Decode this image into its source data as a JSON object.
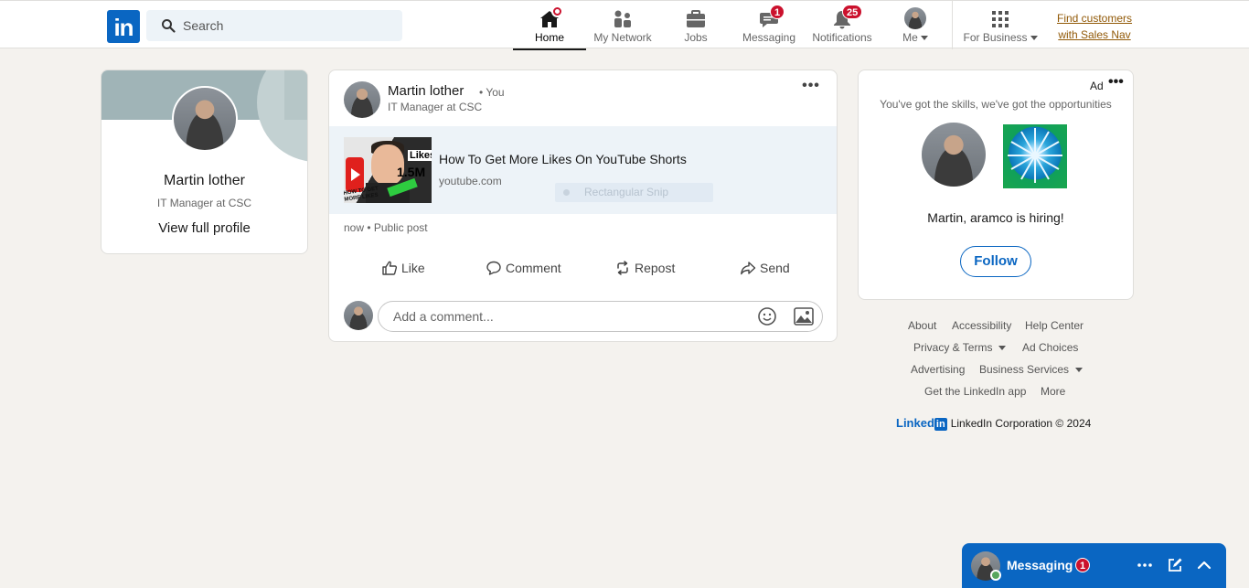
{
  "nav": {
    "logo_text": "in",
    "search": {
      "placeholder": "Search"
    },
    "items": [
      {
        "label": "Home",
        "icon": "home-icon",
        "active": true
      },
      {
        "label": "My Network",
        "icon": "network-icon"
      },
      {
        "label": "Jobs",
        "icon": "briefcase-icon"
      },
      {
        "label": "Messaging",
        "icon": "chat-icon",
        "badge": "1"
      },
      {
        "label": "Notifications",
        "icon": "bell-icon",
        "badge": "25"
      },
      {
        "label": "Me",
        "icon": "avatar"
      },
      {
        "label": "For Business",
        "icon": "grid-icon"
      }
    ],
    "sales_nav": {
      "line1": "Find customers",
      "line2": "with Sales Nav"
    }
  },
  "profile": {
    "name": "Martin lother",
    "title": "IT Manager at CSC",
    "link": "View full profile"
  },
  "post": {
    "author": "Martin lother",
    "you_tag": "• You",
    "author_title": "IT Manager at CSC",
    "more": "•••",
    "link": {
      "title": "How To Get More Likes On YouTube Shorts",
      "domain": "youtube.com",
      "thumb_text1": "Likes",
      "thumb_text2": "1.5M",
      "thumb_text3": "HOW TO GET MORE LIKES"
    },
    "snip_overlay": "Rectangular Snip",
    "meta": "now • Public post",
    "actions": {
      "like": "Like",
      "comment": "Comment",
      "repost": "Repost",
      "send": "Send"
    },
    "comment_placeholder": "Add a comment..."
  },
  "ad": {
    "label": "Ad",
    "more": "•••",
    "tagline": "You've got the skills, we've got the opportunities",
    "hiring_prefix": "Martin, ",
    "hiring_company": "aramco",
    "hiring_suffix": " is hiring!",
    "follow": "Follow"
  },
  "footer": {
    "links": {
      "about": "About",
      "accessibility": "Accessibility",
      "help_center": "Help Center",
      "privacy_terms": "Privacy & Terms",
      "ad_choices": "Ad Choices",
      "advertising": "Advertising",
      "business_services": "Business Services",
      "get_app": "Get the LinkedIn app",
      "more": "More"
    },
    "brand_word": "Linked",
    "brand_in": "in",
    "copyright": "LinkedIn Corporation © 2024"
  },
  "messaging_dock": {
    "label": "Messaging",
    "badge": "1"
  },
  "colors": {
    "brand": "#0a66c2",
    "badge": "#cb112d",
    "background": "#f4f2ee",
    "sales_nav": "#915907"
  }
}
